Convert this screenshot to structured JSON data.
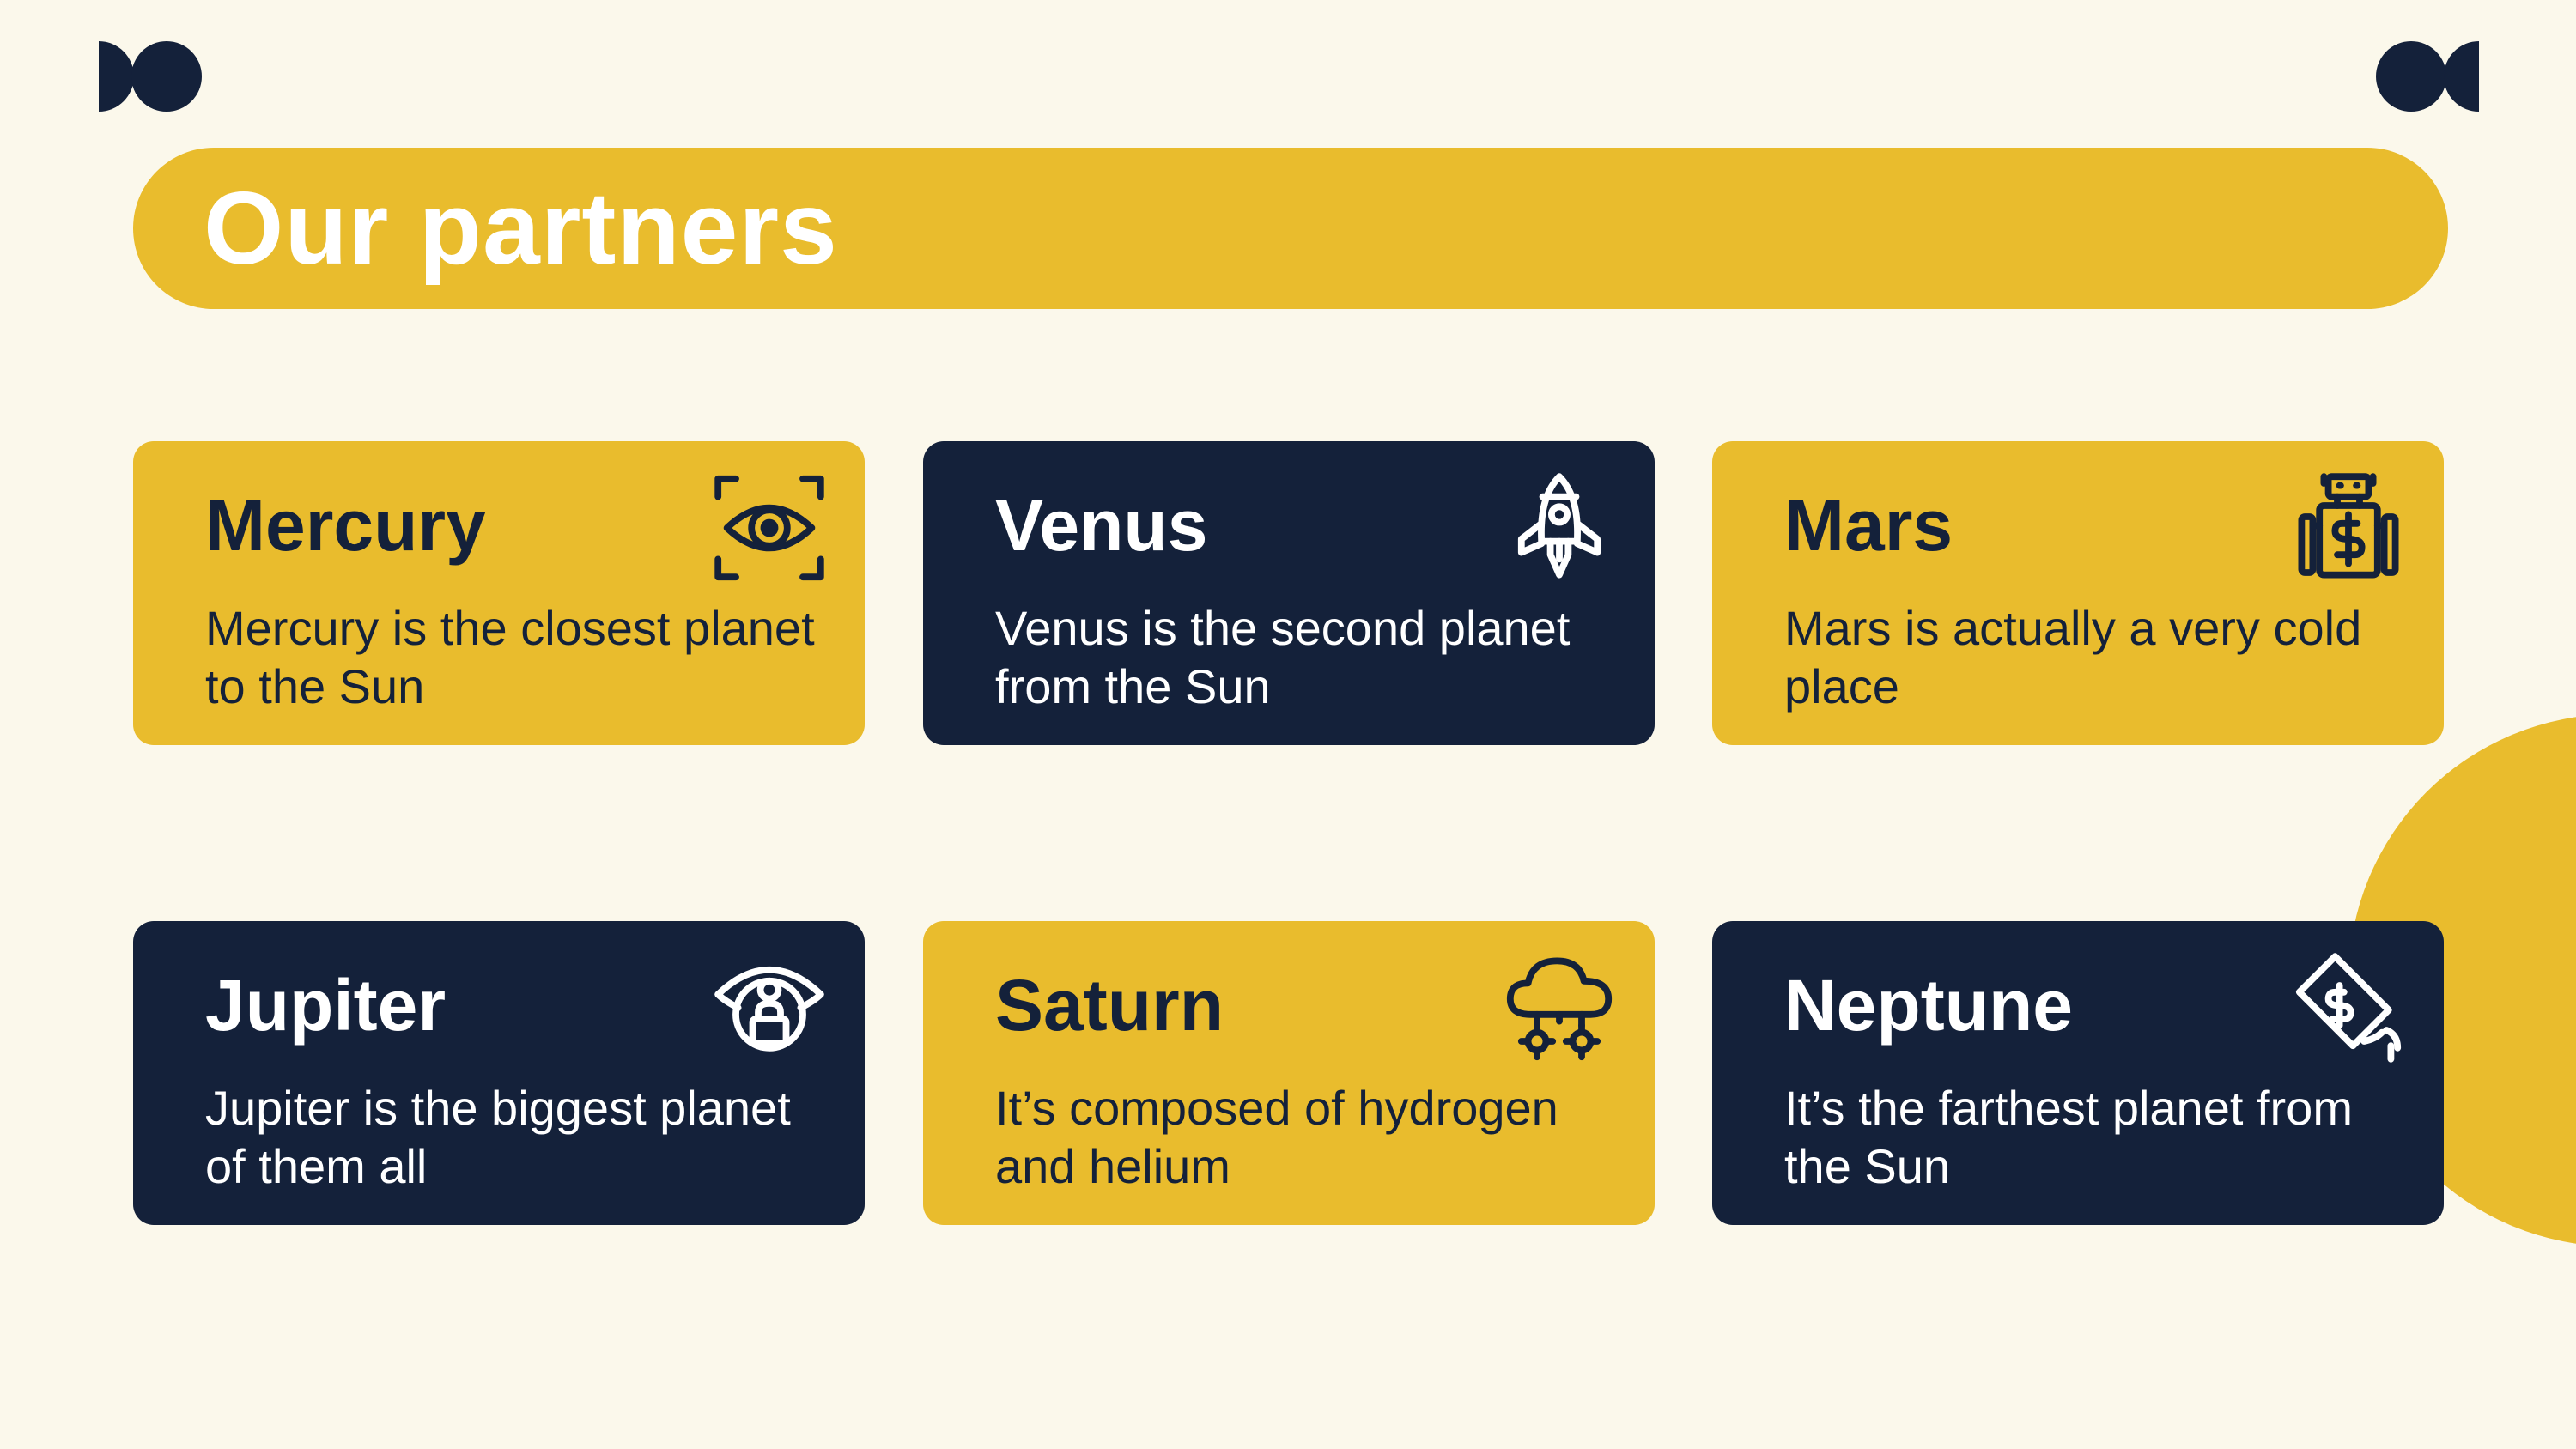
{
  "slide": {
    "title": "Our partners",
    "colors": {
      "background": "#FBF8EB",
      "accent_yellow": "#E9BC2D",
      "navy": "#14213A",
      "white": "#FFFFFF"
    }
  },
  "cards": [
    {
      "title": "Mercury",
      "description": "Mercury is the closest planet to the Sun",
      "style": "yellow",
      "icon": "eye-scan-icon"
    },
    {
      "title": "Venus",
      "description": "Venus is the second planet from the Sun",
      "style": "navy",
      "icon": "rocket-icon"
    },
    {
      "title": "Mars",
      "description": "Mars is actually a very cold place",
      "style": "yellow",
      "icon": "robot-dollar-icon"
    },
    {
      "title": "Jupiter",
      "description": "Jupiter is the biggest planet of them all",
      "style": "navy",
      "icon": "eye-lock-icon"
    },
    {
      "title": "Saturn",
      "description": "It’s composed of hydrogen and helium",
      "style": "yellow",
      "icon": "cloud-gears-icon"
    },
    {
      "title": "Neptune",
      "description": "It’s the farthest planet from the Sun",
      "style": "navy",
      "icon": "price-tag-icon"
    }
  ]
}
